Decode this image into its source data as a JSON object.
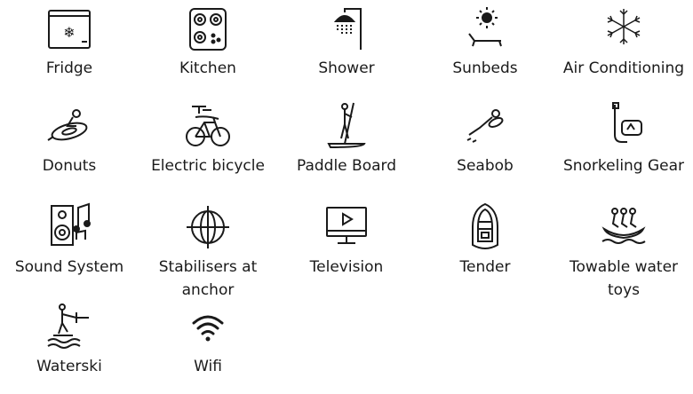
{
  "amenities": [
    {
      "label": "Fridge",
      "icon": "fridge-icon"
    },
    {
      "label": "Kitchen",
      "icon": "stove-icon"
    },
    {
      "label": "Shower",
      "icon": "shower-icon"
    },
    {
      "label": "Sunbeds",
      "icon": "sunbed-icon"
    },
    {
      "label": "Air Conditioning",
      "icon": "snowflake-icon"
    },
    {
      "label": "Donuts",
      "icon": "donut-ride-icon"
    },
    {
      "label": "Electric bicycle",
      "icon": "electric-bicycle-icon"
    },
    {
      "label": "Paddle Board",
      "icon": "paddle-board-icon"
    },
    {
      "label": "Seabob",
      "icon": "seabob-icon"
    },
    {
      "label": "Snorkeling Gear",
      "icon": "snorkel-mask-icon"
    },
    {
      "label": "Sound System",
      "icon": "speaker-music-icon"
    },
    {
      "label": "Stabilisers at anchor",
      "icon": "stabiliser-icon"
    },
    {
      "label": "Television",
      "icon": "television-icon"
    },
    {
      "label": "Tender",
      "icon": "tender-boat-icon"
    },
    {
      "label": "Towable water toys",
      "icon": "towable-toy-icon"
    },
    {
      "label": "Waterski",
      "icon": "waterski-icon"
    },
    {
      "label": "Wifi",
      "icon": "wifi-icon"
    }
  ]
}
